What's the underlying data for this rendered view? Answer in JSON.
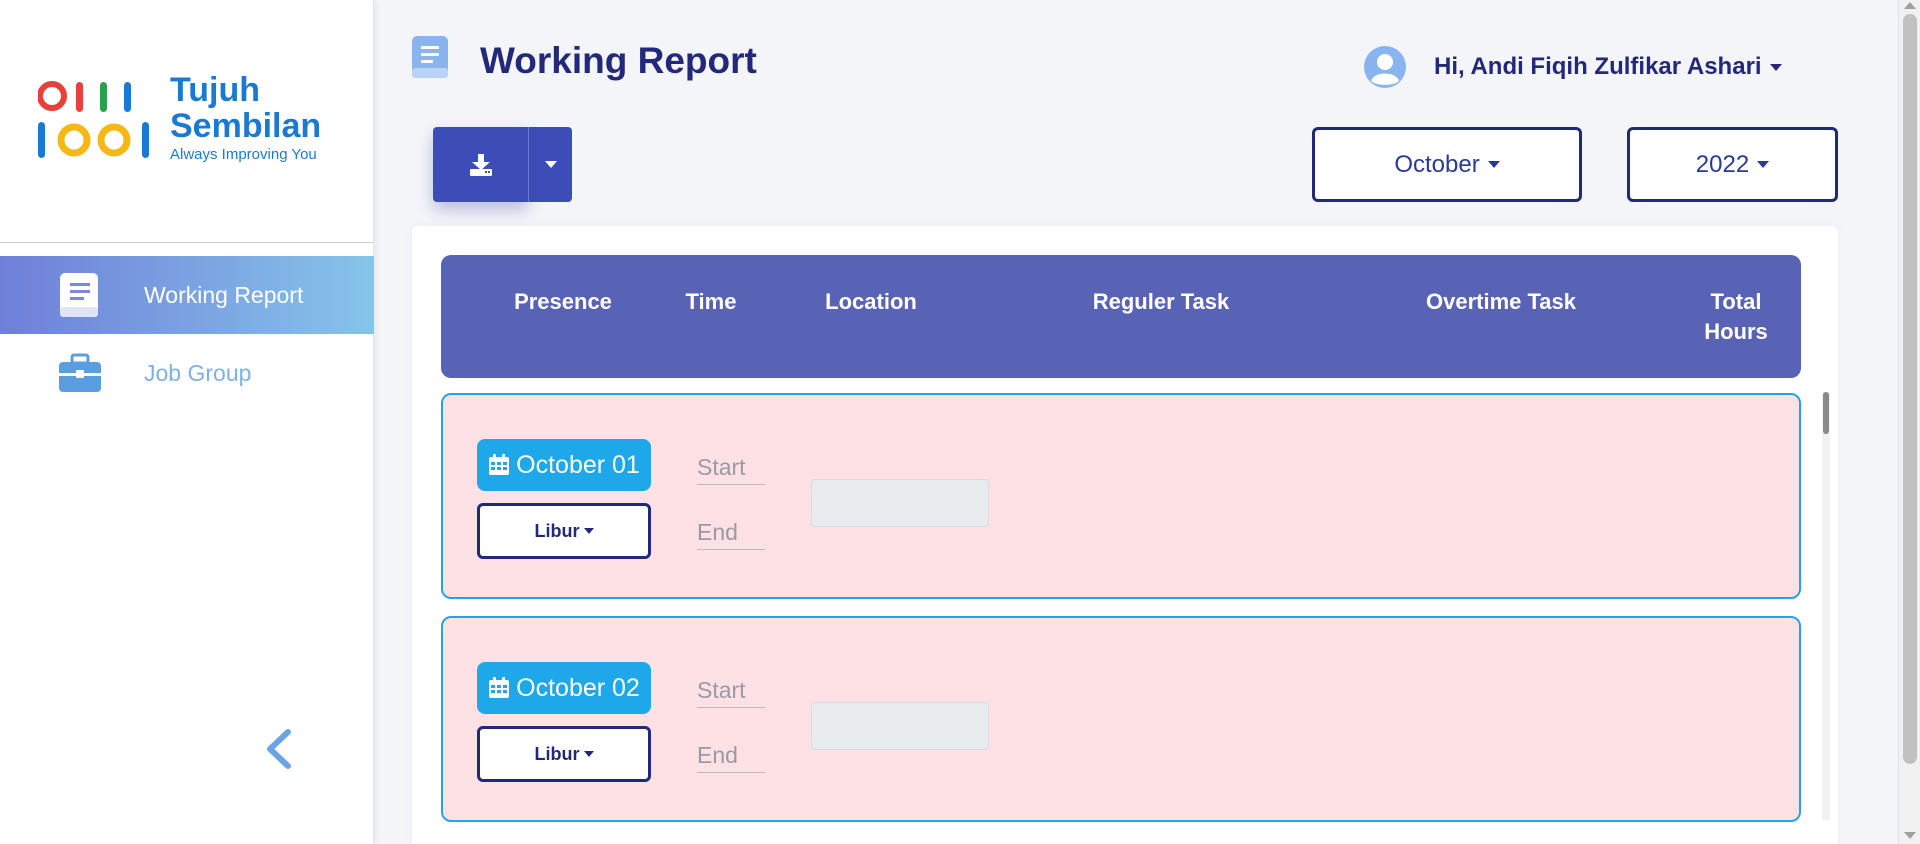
{
  "brand": {
    "line1": "Tujuh",
    "line2": "Sembilan",
    "tagline": "Always Improving You",
    "colors": {
      "red": "#e8403a",
      "blue": "#1a7ad3",
      "green": "#2aa04a",
      "yellow": "#f6b812"
    }
  },
  "sidebar": {
    "items": [
      {
        "label": "Working Report",
        "icon": "book-icon",
        "active": true
      },
      {
        "label": "Job Group",
        "icon": "briefcase-icon",
        "active": false
      }
    ],
    "collapse_icon": "chevron-left-icon"
  },
  "header": {
    "title": "Working Report",
    "title_icon": "book-icon",
    "user_greeting": "Hi, Andi Fiqih Zulfikar Ashari"
  },
  "toolbar": {
    "download_icon": "download-icon",
    "month": "October",
    "year": "2022"
  },
  "table": {
    "columns": [
      "Presence",
      "Time",
      "Location",
      "Reguler Task",
      "Overtime Task",
      "Total Hours"
    ],
    "rows": [
      {
        "date": "October 01",
        "presence": "Libur",
        "start_placeholder": "Start",
        "end_placeholder": "End"
      },
      {
        "date": "October 02",
        "presence": "Libur",
        "start_placeholder": "Start",
        "end_placeholder": "End"
      }
    ]
  },
  "colors": {
    "accent": "#3d4db8",
    "table_header": "#5863b5",
    "row_bg": "#fde1e4",
    "row_border": "#22a6e3",
    "date_badge": "#1ea8ea",
    "navy": "#22287a"
  }
}
